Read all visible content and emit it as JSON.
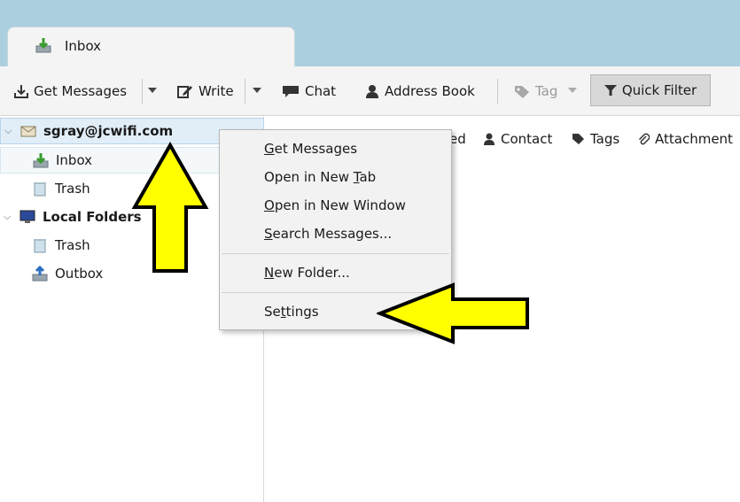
{
  "tabs": [
    {
      "label": "Inbox",
      "icon": "inbox-download-icon"
    }
  ],
  "toolbar": {
    "get_messages": "Get Messages",
    "write": "Write",
    "chat": "Chat",
    "address_book": "Address Book",
    "tag": "Tag",
    "quick_filter": "Quick Filter"
  },
  "folders": {
    "account": "sgray@jcwifi.com",
    "inbox": "Inbox",
    "trash1": "Trash",
    "local_folders": "Local Folders",
    "trash2": "Trash",
    "outbox": "Outbox"
  },
  "quick_filter_bar": {
    "starred_partial": "ed",
    "contact": "Contact",
    "tags": "Tags",
    "attachment": "Attachment"
  },
  "context_menu": {
    "get_messages": {
      "lead": "G",
      "rest": "et Messages"
    },
    "open_new_tab": {
      "pre": "Open in New ",
      "key": "T",
      "post": "ab"
    },
    "open_new_window": {
      "lead": "O",
      "rest": "pen in New Window"
    },
    "search_messages": {
      "lead": "S",
      "rest": "earch Messages..."
    },
    "new_folder": {
      "lead": "N",
      "rest": "ew Folder..."
    },
    "settings": {
      "pre": "Se",
      "key": "t",
      "post": "tings"
    }
  },
  "colors": {
    "tab_strip": "#abcfdf",
    "arrow_fill": "#ffff00",
    "selection": "#e1eef8"
  }
}
